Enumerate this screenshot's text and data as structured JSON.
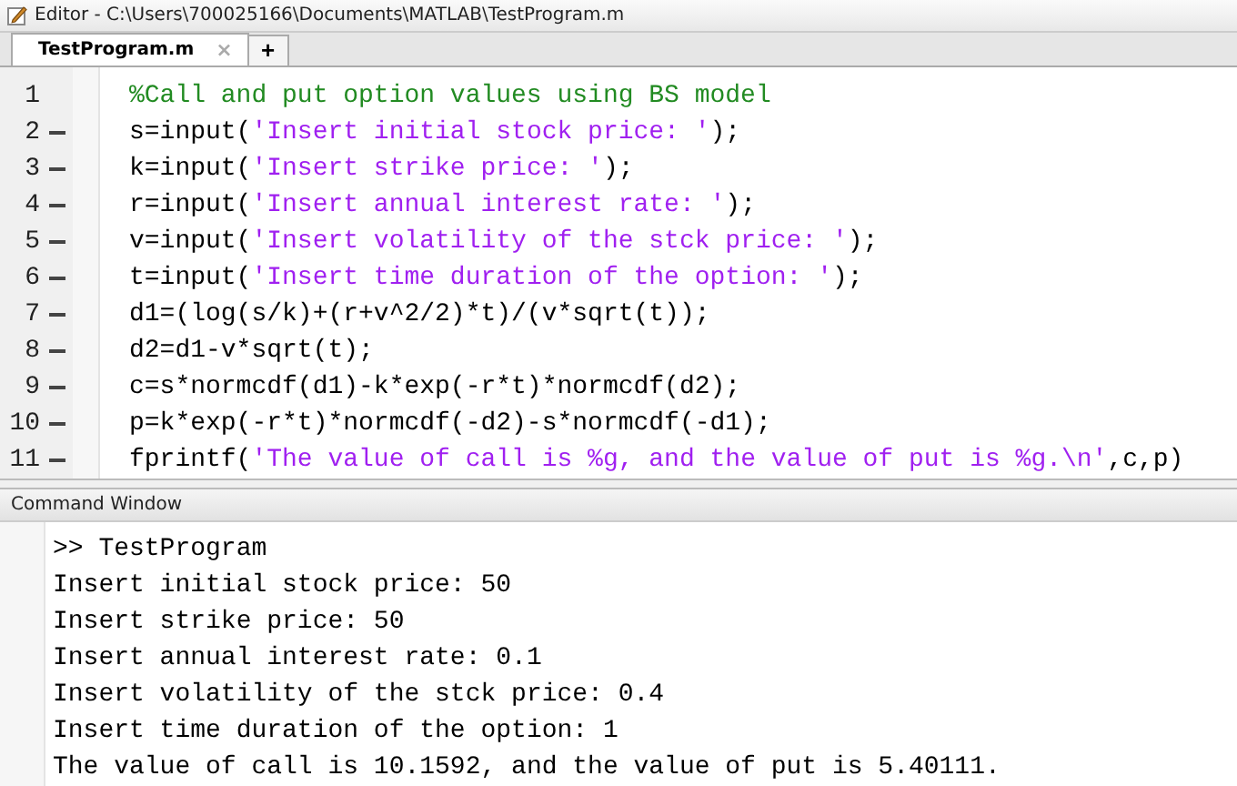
{
  "window": {
    "title": "Editor - C:\\Users\\700025166\\Documents\\MATLAB\\TestProgram.m"
  },
  "tabs": [
    {
      "label": "TestProgram.m",
      "selected": true,
      "close": "×"
    }
  ],
  "new_tab": "+",
  "editor": {
    "lines": [
      {
        "number": "1",
        "executable": false,
        "segments": [
          {
            "kind": "comment",
            "text": "%Call and put option values using BS model"
          }
        ]
      },
      {
        "number": "2",
        "executable": true,
        "segments": [
          {
            "kind": "code",
            "text": "s=input("
          },
          {
            "kind": "string",
            "text": "'Insert initial stock price: '"
          },
          {
            "kind": "code",
            "text": ");"
          }
        ]
      },
      {
        "number": "3",
        "executable": true,
        "segments": [
          {
            "kind": "code",
            "text": "k=input("
          },
          {
            "kind": "string",
            "text": "'Insert strike price: '"
          },
          {
            "kind": "code",
            "text": ");"
          }
        ]
      },
      {
        "number": "4",
        "executable": true,
        "segments": [
          {
            "kind": "code",
            "text": "r=input("
          },
          {
            "kind": "string",
            "text": "'Insert annual interest rate: '"
          },
          {
            "kind": "code",
            "text": ");"
          }
        ]
      },
      {
        "number": "5",
        "executable": true,
        "segments": [
          {
            "kind": "code",
            "text": "v=input("
          },
          {
            "kind": "string",
            "text": "'Insert volatility of the stck price: '"
          },
          {
            "kind": "code",
            "text": ");"
          }
        ]
      },
      {
        "number": "6",
        "executable": true,
        "segments": [
          {
            "kind": "code",
            "text": "t=input("
          },
          {
            "kind": "string",
            "text": "'Insert time duration of the option: '"
          },
          {
            "kind": "code",
            "text": ");"
          }
        ]
      },
      {
        "number": "7",
        "executable": true,
        "segments": [
          {
            "kind": "code",
            "text": "d1=(log(s/k)+(r+v^2/2)*t)/(v*sqrt(t));"
          }
        ]
      },
      {
        "number": "8",
        "executable": true,
        "segments": [
          {
            "kind": "code",
            "text": "d2=d1-v*sqrt(t);"
          }
        ]
      },
      {
        "number": "9",
        "executable": true,
        "segments": [
          {
            "kind": "code",
            "text": "c=s*normcdf(d1)-k*exp(-r*t)*normcdf(d2);"
          }
        ]
      },
      {
        "number": "10",
        "executable": true,
        "segments": [
          {
            "kind": "code",
            "text": "p=k*exp(-r*t)*normcdf(-d2)-s*normcdf(-d1);"
          }
        ]
      },
      {
        "number": "11",
        "executable": true,
        "segments": [
          {
            "kind": "code",
            "text": "fprintf("
          },
          {
            "kind": "string",
            "text": "'The value of call is %g, and the value of put is %g.\\n'"
          },
          {
            "kind": "code",
            "text": ",c,p)"
          }
        ]
      }
    ]
  },
  "command_window": {
    "title": "Command Window",
    "lines": [
      ">> TestProgram",
      "Insert initial stock price: 50",
      "Insert strike price: 50",
      "Insert annual interest rate: 0.1",
      "Insert volatility of the stck price: 0.4",
      "Insert time duration of the option: 1",
      "The value of call is 10.1592, and the value of put is 5.40111."
    ]
  }
}
